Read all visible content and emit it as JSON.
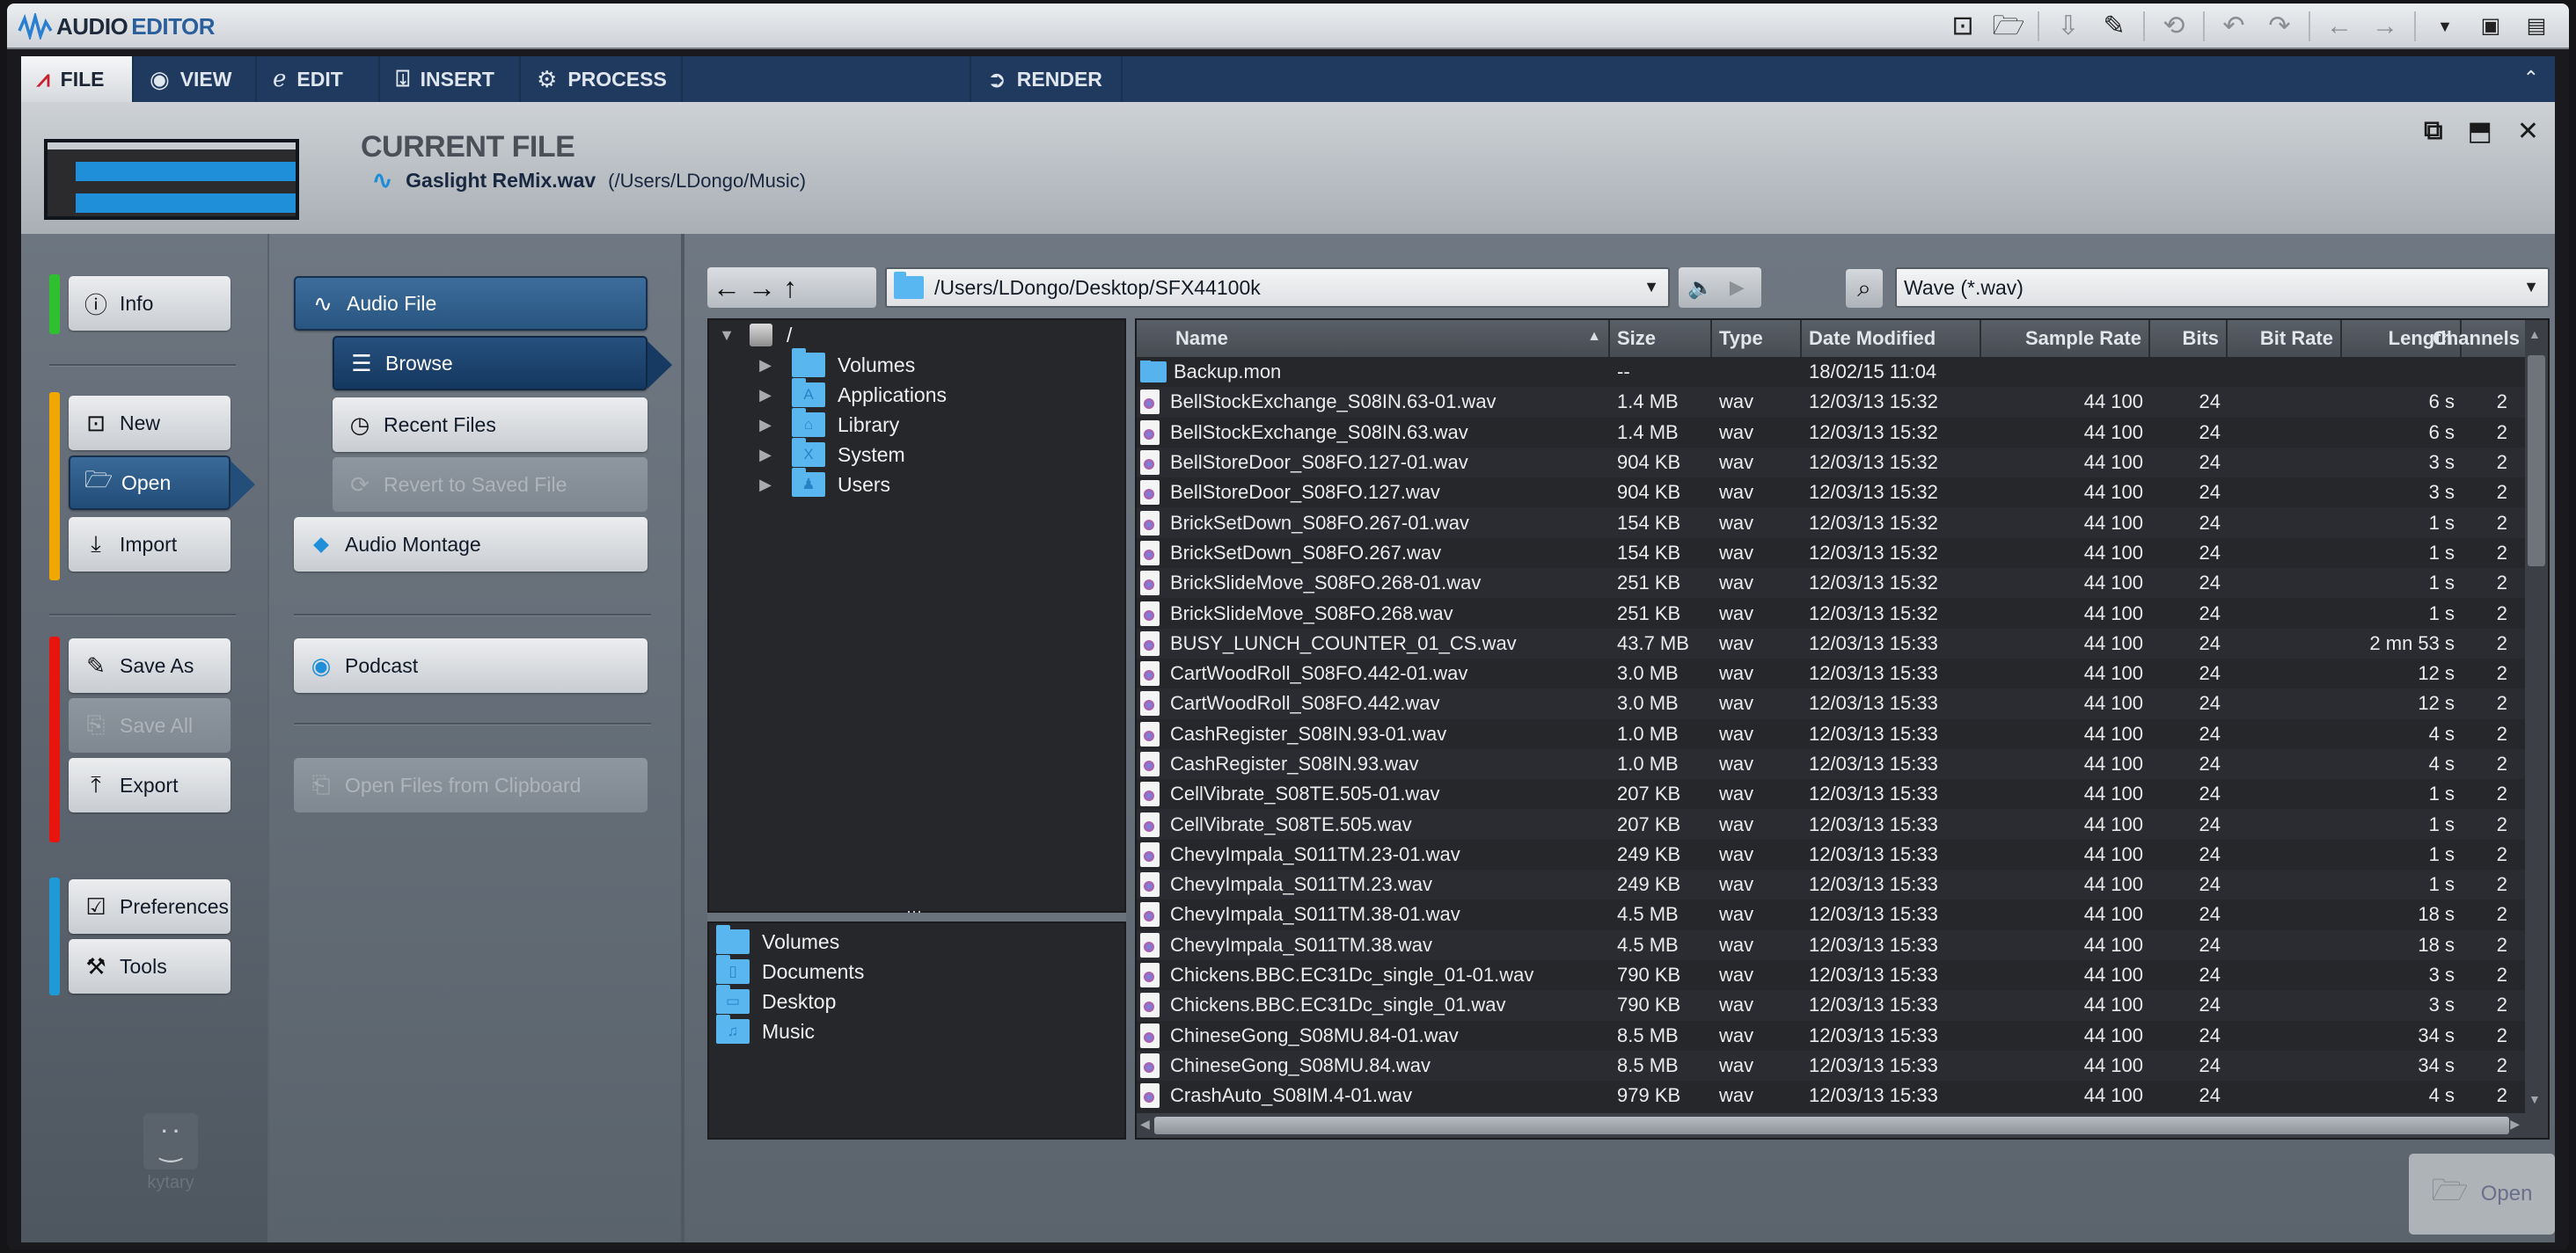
{
  "app": {
    "name_part1": "AUDIO",
    "name_part2": "EDITOR",
    "toolbar_icons": [
      "new-file-icon",
      "open-folder-icon",
      "save-icon",
      "save-as-icon",
      "revert-icon",
      "undo-icon",
      "redo-icon",
      "back-icon",
      "forward-icon",
      "dropdown-icon",
      "window-layout-icon",
      "panel-layout-icon"
    ]
  },
  "tabs": [
    {
      "label": "FILE",
      "icon": "file-tab-icon",
      "active": true
    },
    {
      "label": "VIEW",
      "icon": "eye-icon",
      "active": false
    },
    {
      "label": "EDIT",
      "icon": "edit-icon",
      "active": false
    },
    {
      "label": "INSERT",
      "icon": "insert-icon",
      "active": false
    },
    {
      "label": "PROCESS",
      "icon": "gears-icon",
      "active": false
    },
    {
      "label": "RENDER",
      "icon": "render-icon",
      "active": false
    }
  ],
  "current_file": {
    "title": "CURRENT FILE",
    "name": "Gaslight ReMix.wav",
    "path": "(/Users/LDongo/Music)"
  },
  "left_menu": {
    "info": "Info",
    "new": "New",
    "open": "Open",
    "import": "Import",
    "save_as": "Save As",
    "save_all": "Save All",
    "export": "Export",
    "preferences": "Preferences",
    "tools": "Tools",
    "logo_text": "kytary",
    "colors": {
      "info": "#2ec02e",
      "file": "#f0a800",
      "save": "#e8140e",
      "settings": "#1e9ad6"
    }
  },
  "open_menu": {
    "audio_file": "Audio File",
    "browse": "Browse",
    "recent_files": "Recent Files",
    "revert": "Revert to Saved File",
    "audio_montage": "Audio Montage",
    "podcast": "Podcast",
    "open_from_clipboard": "Open Files from Clipboard"
  },
  "browser": {
    "path": "/Users/LDongo/Desktop/SFX44100k",
    "filter": "Wave (*.wav)",
    "tree_root": "/",
    "tree": [
      "Volumes",
      "Applications",
      "Library",
      "System",
      "Users"
    ],
    "favorites": [
      "Volumes",
      "Documents",
      "Desktop",
      "Music"
    ],
    "open_button": "Open"
  },
  "table": {
    "columns": [
      "Name",
      "Size",
      "Type",
      "Date Modified",
      "Sample Rate",
      "Bits",
      "Bit Rate",
      "Length",
      "Channels"
    ],
    "rows": [
      {
        "name": "Backup.mon",
        "folder": true,
        "size": "--",
        "type": "",
        "date": "18/02/15 11:04",
        "rate": "",
        "bits": "",
        "bitrate": "",
        "length": "",
        "ch": ""
      },
      {
        "name": "BellStockExchange_S08IN.63-01.wav",
        "size": "1.4 MB",
        "type": "wav",
        "date": "12/03/13 15:32",
        "rate": "44 100",
        "bits": "24",
        "bitrate": "",
        "length": "6 s",
        "ch": "2"
      },
      {
        "name": "BellStockExchange_S08IN.63.wav",
        "size": "1.4 MB",
        "type": "wav",
        "date": "12/03/13 15:32",
        "rate": "44 100",
        "bits": "24",
        "bitrate": "",
        "length": "6 s",
        "ch": "2"
      },
      {
        "name": "BellStoreDoor_S08FO.127-01.wav",
        "size": "904 KB",
        "type": "wav",
        "date": "12/03/13 15:32",
        "rate": "44 100",
        "bits": "24",
        "bitrate": "",
        "length": "3 s",
        "ch": "2"
      },
      {
        "name": "BellStoreDoor_S08FO.127.wav",
        "size": "904 KB",
        "type": "wav",
        "date": "12/03/13 15:32",
        "rate": "44 100",
        "bits": "24",
        "bitrate": "",
        "length": "3 s",
        "ch": "2"
      },
      {
        "name": "BrickSetDown_S08FO.267-01.wav",
        "size": "154 KB",
        "type": "wav",
        "date": "12/03/13 15:32",
        "rate": "44 100",
        "bits": "24",
        "bitrate": "",
        "length": "1 s",
        "ch": "2"
      },
      {
        "name": "BrickSetDown_S08FO.267.wav",
        "size": "154 KB",
        "type": "wav",
        "date": "12/03/13 15:32",
        "rate": "44 100",
        "bits": "24",
        "bitrate": "",
        "length": "1 s",
        "ch": "2"
      },
      {
        "name": "BrickSlideMove_S08FO.268-01.wav",
        "size": "251 KB",
        "type": "wav",
        "date": "12/03/13 15:32",
        "rate": "44 100",
        "bits": "24",
        "bitrate": "",
        "length": "1 s",
        "ch": "2"
      },
      {
        "name": "BrickSlideMove_S08FO.268.wav",
        "size": "251 KB",
        "type": "wav",
        "date": "12/03/13 15:32",
        "rate": "44 100",
        "bits": "24",
        "bitrate": "",
        "length": "1 s",
        "ch": "2"
      },
      {
        "name": "BUSY_LUNCH_COUNTER_01_CS.wav",
        "size": "43.7 MB",
        "type": "wav",
        "date": "12/03/13 15:33",
        "rate": "44 100",
        "bits": "24",
        "bitrate": "",
        "length": "2 mn 53 s",
        "ch": "2"
      },
      {
        "name": "CartWoodRoll_S08FO.442-01.wav",
        "size": "3.0 MB",
        "type": "wav",
        "date": "12/03/13 15:33",
        "rate": "44 100",
        "bits": "24",
        "bitrate": "",
        "length": "12 s",
        "ch": "2"
      },
      {
        "name": "CartWoodRoll_S08FO.442.wav",
        "size": "3.0 MB",
        "type": "wav",
        "date": "12/03/13 15:33",
        "rate": "44 100",
        "bits": "24",
        "bitrate": "",
        "length": "12 s",
        "ch": "2"
      },
      {
        "name": "CashRegister_S08IN.93-01.wav",
        "size": "1.0 MB",
        "type": "wav",
        "date": "12/03/13 15:33",
        "rate": "44 100",
        "bits": "24",
        "bitrate": "",
        "length": "4 s",
        "ch": "2"
      },
      {
        "name": "CashRegister_S08IN.93.wav",
        "size": "1.0 MB",
        "type": "wav",
        "date": "12/03/13 15:33",
        "rate": "44 100",
        "bits": "24",
        "bitrate": "",
        "length": "4 s",
        "ch": "2"
      },
      {
        "name": "CellVibrate_S08TE.505-01.wav",
        "size": "207 KB",
        "type": "wav",
        "date": "12/03/13 15:33",
        "rate": "44 100",
        "bits": "24",
        "bitrate": "",
        "length": "1 s",
        "ch": "2"
      },
      {
        "name": "CellVibrate_S08TE.505.wav",
        "size": "207 KB",
        "type": "wav",
        "date": "12/03/13 15:33",
        "rate": "44 100",
        "bits": "24",
        "bitrate": "",
        "length": "1 s",
        "ch": "2"
      },
      {
        "name": "ChevyImpala_S011TM.23-01.wav",
        "size": "249 KB",
        "type": "wav",
        "date": "12/03/13 15:33",
        "rate": "44 100",
        "bits": "24",
        "bitrate": "",
        "length": "1 s",
        "ch": "2"
      },
      {
        "name": "ChevyImpala_S011TM.23.wav",
        "size": "249 KB",
        "type": "wav",
        "date": "12/03/13 15:33",
        "rate": "44 100",
        "bits": "24",
        "bitrate": "",
        "length": "1 s",
        "ch": "2"
      },
      {
        "name": "ChevyImpala_S011TM.38-01.wav",
        "size": "4.5 MB",
        "type": "wav",
        "date": "12/03/13 15:33",
        "rate": "44 100",
        "bits": "24",
        "bitrate": "",
        "length": "18 s",
        "ch": "2"
      },
      {
        "name": "ChevyImpala_S011TM.38.wav",
        "size": "4.5 MB",
        "type": "wav",
        "date": "12/03/13 15:33",
        "rate": "44 100",
        "bits": "24",
        "bitrate": "",
        "length": "18 s",
        "ch": "2"
      },
      {
        "name": "Chickens.BBC.EC31Dc_single_01-01.wav",
        "size": "790 KB",
        "type": "wav",
        "date": "12/03/13 15:33",
        "rate": "44 100",
        "bits": "24",
        "bitrate": "",
        "length": "3 s",
        "ch": "2"
      },
      {
        "name": "Chickens.BBC.EC31Dc_single_01.wav",
        "size": "790 KB",
        "type": "wav",
        "date": "12/03/13 15:33",
        "rate": "44 100",
        "bits": "24",
        "bitrate": "",
        "length": "3 s",
        "ch": "2"
      },
      {
        "name": "ChineseGong_S08MU.84-01.wav",
        "size": "8.5 MB",
        "type": "wav",
        "date": "12/03/13 15:33",
        "rate": "44 100",
        "bits": "24",
        "bitrate": "",
        "length": "34 s",
        "ch": "2"
      },
      {
        "name": "ChineseGong_S08MU.84.wav",
        "size": "8.5 MB",
        "type": "wav",
        "date": "12/03/13 15:33",
        "rate": "44 100",
        "bits": "24",
        "bitrate": "",
        "length": "34 s",
        "ch": "2"
      },
      {
        "name": "CrashAuto_S08IM.4-01.wav",
        "size": "979 KB",
        "type": "wav",
        "date": "12/03/13 15:33",
        "rate": "44 100",
        "bits": "24",
        "bitrate": "",
        "length": "4 s",
        "ch": "2"
      }
    ]
  }
}
